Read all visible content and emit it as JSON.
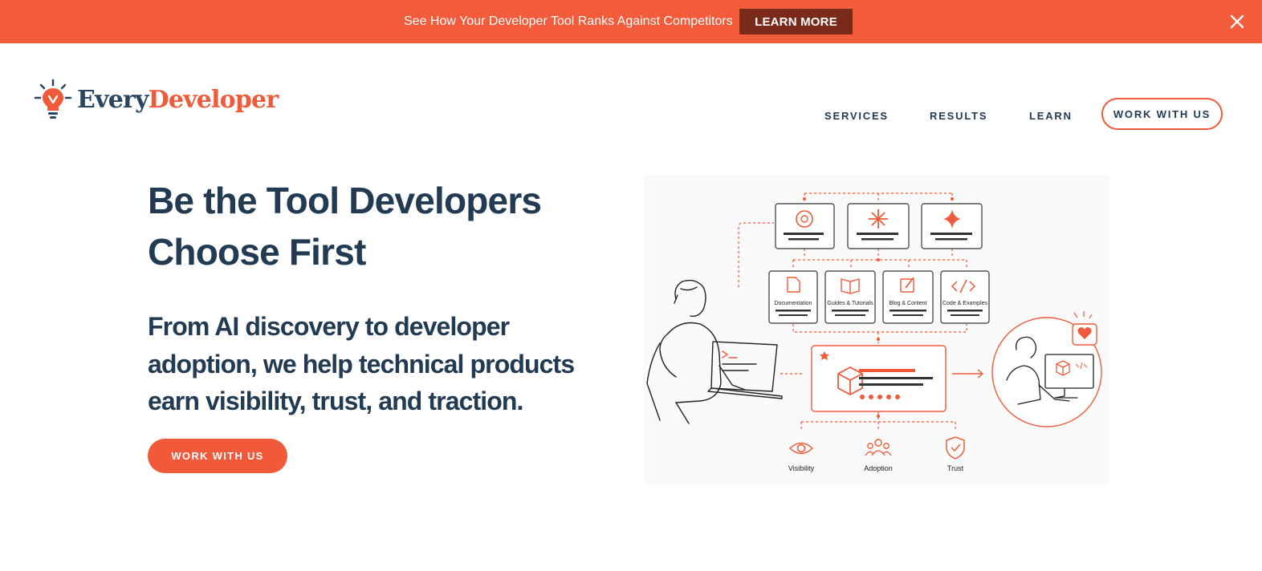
{
  "announcement": {
    "text": "See How Your Developer Tool Ranks Against Competitors",
    "button_label": "LEARN MORE"
  },
  "brand": {
    "name_part1": "Every",
    "name_part2": "Developer",
    "accent_color": "#f05a3a",
    "dark_color": "#223a52"
  },
  "nav": {
    "items": [
      "SERVICES",
      "RESULTS",
      "LEARN"
    ],
    "cta_label": "WORK WITH US"
  },
  "hero": {
    "headline_line1": "Be the Tool Developers",
    "headline_line2": "Choose First",
    "subheadline_line1": "From AI discovery to developer",
    "subheadline_line2": "adoption, we help technical products",
    "subheadline_line3": "earn visibility, trust, and traction.",
    "cta_label": "WORK WITH US"
  },
  "illustration": {
    "content_cards": [
      "Documentation",
      "Guides & Tutorials",
      "Blog & Content",
      "Code & Examples"
    ],
    "outcomes": [
      "Visibility",
      "Adoption",
      "Trust"
    ]
  }
}
